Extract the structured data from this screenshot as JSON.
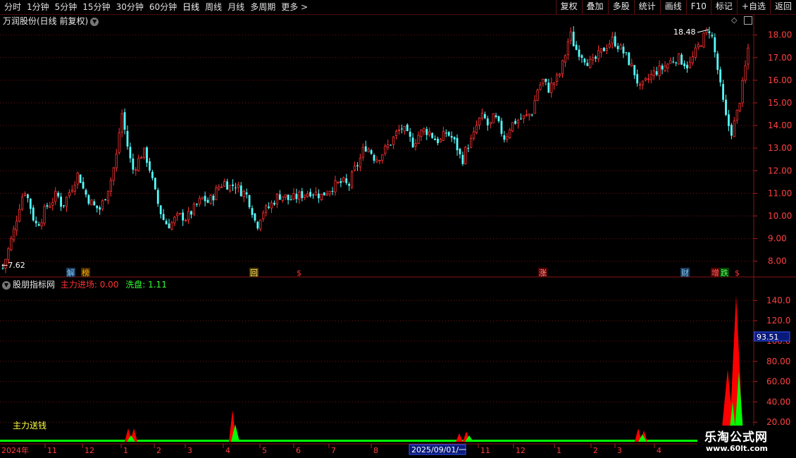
{
  "toolbar": {
    "periods": [
      "分时",
      "1分钟",
      "5分钟",
      "15分钟",
      "30分钟",
      "60分钟",
      "日线",
      "周线",
      "月线",
      "多周期",
      "更多 >"
    ],
    "active_period": "日线",
    "tools": [
      "复权",
      "叠加",
      "多股",
      "统计",
      "画线",
      "F10",
      "标记",
      "+自选",
      "返回"
    ]
  },
  "stock": {
    "title": "万润股份(日线 前复权)",
    "low_label": "←7.62",
    "high_label": "18.48"
  },
  "main_axis": [
    "18.00",
    "17.00",
    "16.00",
    "15.00",
    "14.00",
    "13.00",
    "12.00",
    "11.00",
    "10.00",
    "9.00",
    "8.00"
  ],
  "markers": [
    {
      "text": "解",
      "color": "#7ec8ff",
      "bg": "#1d3c5a"
    },
    {
      "text": "榜",
      "color": "#ffb000",
      "bg": "#4a2a00"
    },
    {
      "text": "回",
      "color": "#ffdd66",
      "bg": "#4a3a00"
    },
    {
      "text": "$",
      "color": "#ff3333",
      "bg": ""
    },
    {
      "text": "涨",
      "color": "#ff9999",
      "bg": "#5a0000"
    },
    {
      "text": "财",
      "color": "#7ec8ff",
      "bg": "#1d3c5a"
    },
    {
      "text": "增",
      "color": "#ff6666",
      "bg": "#5a0000"
    },
    {
      "text": "跌",
      "color": "#66ff66",
      "bg": "#004400"
    },
    {
      "text": "$",
      "color": "#ff3333",
      "bg": ""
    }
  ],
  "indicator": {
    "name": "股朋指标网",
    "main_label": "主力进场: 0.00",
    "wash_label": "洗盘: 1.11",
    "note": "主力送钱",
    "current_value": "93.51",
    "axis": [
      "140.0",
      "120.0",
      "100.0",
      "80.00",
      "60.00",
      "40.00",
      "20.00"
    ]
  },
  "date_axis": {
    "labels": [
      "2024年",
      "11",
      "12",
      "1",
      "2",
      "3",
      "4",
      "5",
      "6",
      "7",
      "8",
      "2025/09/01/一",
      "11",
      "12",
      "1",
      "2",
      "3",
      "4"
    ]
  },
  "logo": {
    "name": "乐淘公式网",
    "url": "www.60lt.com"
  },
  "colors": {
    "up": "#ff3333",
    "down": "#54ffff",
    "green": "#00ff00",
    "red": "#ff0000",
    "grid": "#7a1010"
  },
  "chart_data": {
    "type": "candlestick",
    "title": "万润股份(日线 前复权)",
    "ylim": [
      7.4,
      18.8
    ],
    "high": 18.48,
    "low": 7.62,
    "close_path": [
      7.7,
      8.5,
      9.3,
      10.4,
      11.2,
      10.5,
      9.6,
      9.8,
      10.4,
      10.6,
      11.0,
      10.4,
      10.9,
      11.4,
      11.9,
      11.1,
      10.7,
      10.4,
      10.3,
      10.9,
      11.6,
      12.6,
      14.6,
      13.2,
      12.0,
      12.4,
      12.9,
      12.3,
      11.2,
      10.3,
      9.7,
      9.6,
      9.9,
      10.0,
      9.9,
      10.2,
      10.5,
      10.8,
      10.6,
      10.9,
      11.3,
      11.5,
      11.3,
      11.4,
      11.1,
      11.0,
      10.4,
      9.5,
      10.2,
      10.3,
      10.6,
      10.9,
      10.9,
      10.7,
      10.8,
      10.9,
      11.0,
      11.1,
      11.0,
      10.9,
      11.1,
      11.3,
      11.4,
      11.5,
      11.3,
      12.0,
      12.4,
      13.1,
      12.9,
      12.5,
      12.7,
      13.0,
      13.3,
      13.7,
      13.9,
      13.5,
      13.2,
      13.6,
      13.8,
      13.7,
      13.4,
      13.3,
      13.7,
      13.5,
      13.1,
      12.4,
      13.1,
      13.4,
      14.2,
      14.4,
      13.9,
      14.4,
      13.9,
      13.4,
      14.0,
      14.2,
      14.3,
      14.4,
      14.6,
      15.6,
      16.0,
      15.6,
      15.9,
      16.2,
      17.0,
      18.1,
      17.4,
      17.2,
      16.9,
      16.7,
      17.0,
      17.3,
      17.6,
      17.8,
      17.5,
      17.2,
      16.8,
      16.3,
      15.6,
      15.9,
      16.2,
      16.4,
      16.5,
      16.7,
      16.9,
      17.0,
      16.8,
      16.6,
      17.1,
      17.6,
      18.0,
      18.3,
      17.0,
      15.5,
      14.2,
      13.7,
      14.6,
      15.8,
      17.4
    ],
    "indicator": {
      "current": 93.51,
      "ylim": [
        0,
        150
      ],
      "red_spikes": [
        {
          "center": 182,
          "height": 14
        },
        {
          "center": 190,
          "height": 14
        },
        {
          "center": 330,
          "height": 32
        },
        {
          "center": 652,
          "height": 9
        },
        {
          "center": 662,
          "height": 11
        },
        {
          "center": 906,
          "height": 14
        },
        {
          "center": 914,
          "height": 12
        },
        {
          "center": 1033,
          "height": 72
        },
        {
          "center": 1045,
          "height": 145
        }
      ],
      "green_spikes": [
        {
          "center": 186,
          "height": 7
        },
        {
          "center": 334,
          "height": 18
        },
        {
          "center": 666,
          "height": 7
        },
        {
          "center": 912,
          "height": 8
        },
        {
          "center": 1040,
          "height": 40
        },
        {
          "center": 1049,
          "height": 70
        }
      ]
    }
  }
}
